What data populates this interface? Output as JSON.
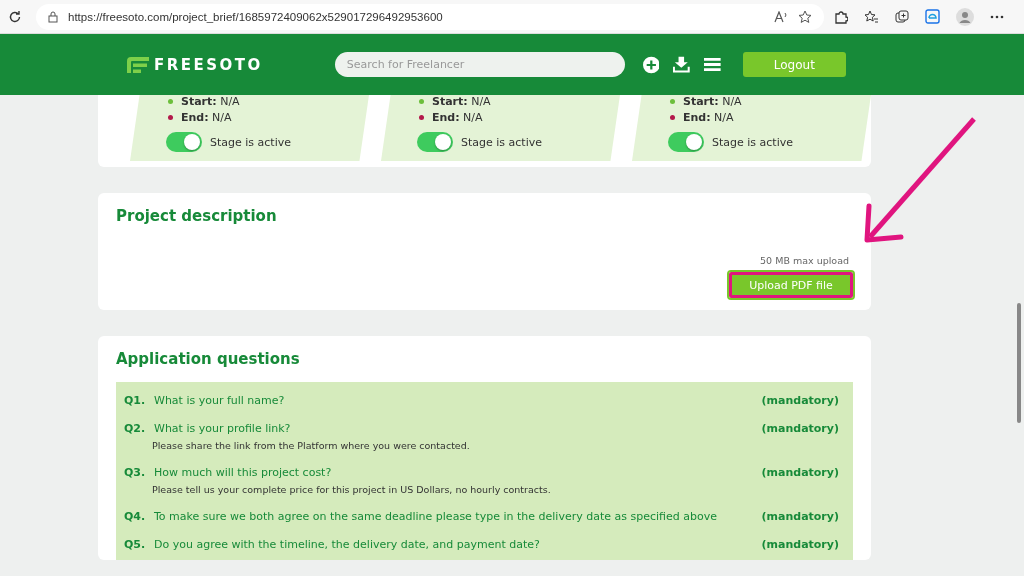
{
  "browser": {
    "url": "https://freesoto.com/project_brief/1685972409062x529017296492953600"
  },
  "header": {
    "logo": "FREESOTO",
    "search": {
      "placeholder": "Search for Freelancer"
    },
    "logout": "Logout"
  },
  "stages": [
    {
      "start_label": "Start:",
      "start": "N/A",
      "end_label": "End:",
      "end": "N/A",
      "active": true,
      "toggle_label": "Stage is active"
    },
    {
      "start_label": "Start:",
      "start": "N/A",
      "end_label": "End:",
      "end": "N/A",
      "active": true,
      "toggle_label": "Stage is active"
    },
    {
      "start_label": "Start:",
      "start": "N/A",
      "end_label": "End:",
      "end": "N/A",
      "active": true,
      "toggle_label": "Stage is active"
    }
  ],
  "description": {
    "title": "Project description",
    "limit": "50 MB max upload",
    "upload": "Upload PDF file",
    "highlighted": true
  },
  "questions": {
    "title": "Application questions",
    "items": [
      {
        "number": "Q1.",
        "text": "What is your full name?",
        "tag": "(mandatory)"
      },
      {
        "number": "Q2.",
        "text": "What is your profile link?",
        "hint": "Please share the link from the Platform where you were contacted.",
        "tag": "(mandatory)"
      },
      {
        "number": "Q3.",
        "text": "How much will this project cost?",
        "hint": "Please tell us your complete price for this project in US Dollars, no hourly contracts.",
        "tag": "(mandatory)"
      },
      {
        "number": "Q4.",
        "text": "To make sure we both agree on the same deadline please type in the delivery date as specified above",
        "tag": "(mandatory)"
      },
      {
        "number": "Q5.",
        "text": "Do you agree with the timeline, the delivery date, and payment date?",
        "tag": "(mandatory)"
      }
    ]
  }
}
